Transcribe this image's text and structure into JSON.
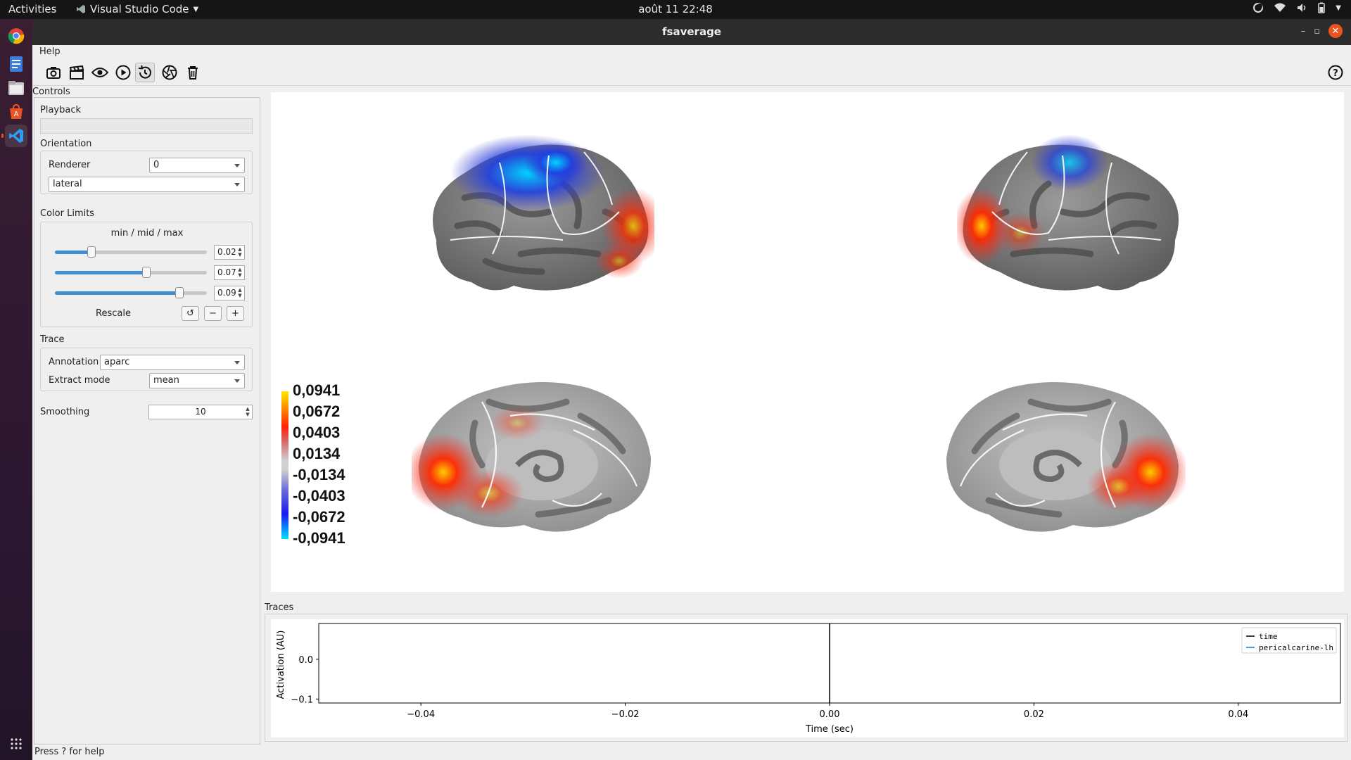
{
  "topbar": {
    "activities": "Activities",
    "app_name": "Visual Studio Code",
    "clock": "août 11  22:48"
  },
  "dock": {
    "items": [
      "chrome-icon",
      "text-editor-icon",
      "files-icon",
      "software-center-icon",
      "vscode-icon"
    ],
    "grid": "show-apps-icon"
  },
  "window": {
    "title": "fsaverage"
  },
  "menu": {
    "help": "Help"
  },
  "toolbar": {
    "buttons": [
      "screenshot",
      "movie",
      "visibility",
      "play",
      "reset",
      "camera",
      "clear"
    ],
    "help": "?"
  },
  "controls": {
    "title": "Controls",
    "playback": {
      "title": "Playback"
    },
    "orientation": {
      "title": "Orientation",
      "renderer_label": "Renderer",
      "renderer_value": "0",
      "view_value": "lateral"
    },
    "color_limits": {
      "title": "Color Limits",
      "subtitle": "min / mid / max",
      "min_value": "0.02",
      "mid_value": "0.07",
      "max_value": "0.09",
      "min_slider": 0.24,
      "mid_slider": 0.6,
      "max_slider": 0.82,
      "rescale_label": "Rescale",
      "reset_symbol": "↺",
      "minus_symbol": "−",
      "plus_symbol": "+"
    },
    "trace": {
      "title": "Trace",
      "annotation_label": "Annotation",
      "annotation_value": "aparc",
      "extract_label": "Extract mode",
      "extract_value": "mean"
    },
    "smoothing": {
      "label": "Smoothing",
      "value": "10"
    }
  },
  "colorbar": {
    "labels": [
      "0,0941",
      "0,0672",
      "0,0403",
      "0,0134",
      "-0,0134",
      "-0,0403",
      "-0,0672",
      "-0,0941"
    ]
  },
  "traces": {
    "title": "Traces"
  },
  "chart_data": {
    "type": "line",
    "xlabel": "Time (sec)",
    "ylabel": "Activation (AU)",
    "xlim": [
      -0.05,
      0.05
    ],
    "ylim": [
      -0.11,
      0.09
    ],
    "xticks": [
      "−0.04",
      "−0.02",
      "0.00",
      "0.02",
      "0.04"
    ],
    "xtick_values": [
      -0.04,
      -0.02,
      0.0,
      0.02,
      0.04
    ],
    "yticks": [
      "0.0",
      "−0.1"
    ],
    "ytick_values": [
      0.0,
      -0.1
    ],
    "series": [
      {
        "name": "time",
        "type": "vline",
        "x": 0.0,
        "color": "#000000"
      },
      {
        "name": "pericalcarine-lh",
        "values": [],
        "color": "#1f77b4"
      }
    ],
    "legend": "top-right"
  },
  "statusbar": {
    "text": "Press ? for help"
  }
}
